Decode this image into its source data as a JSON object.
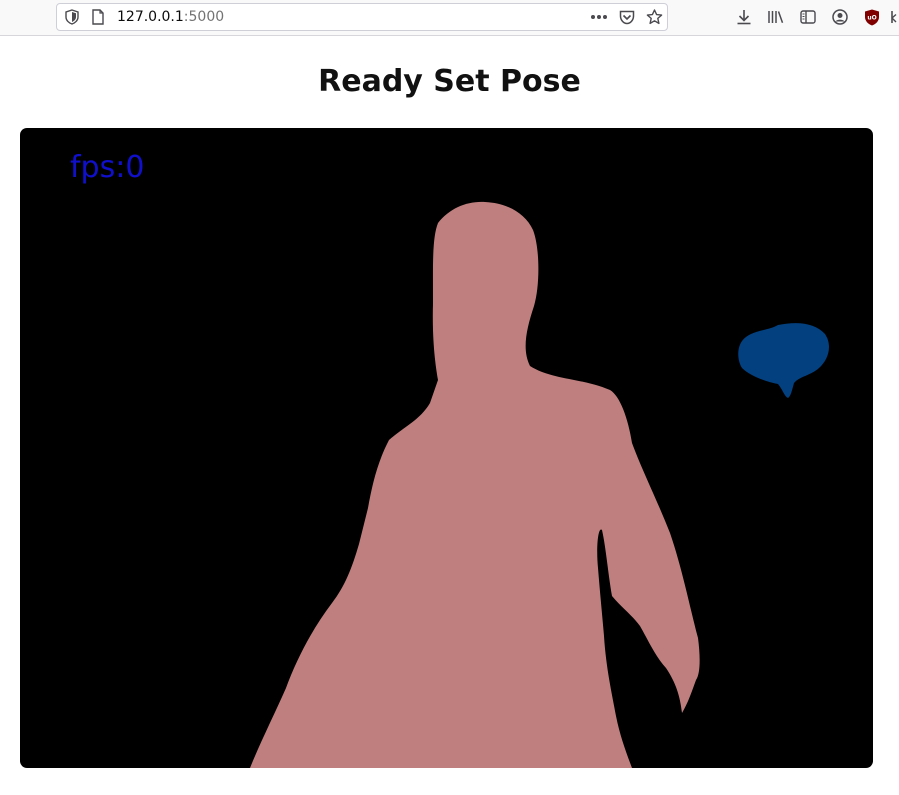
{
  "browser": {
    "url_host": "127.0.0.1",
    "url_port": ":5000",
    "icons": {
      "shield": "tracking-protection-shield-icon",
      "page": "page-info-icon",
      "more": "page-actions-more-icon",
      "pocket": "pocket-icon",
      "bookmark": "bookmark-star-icon",
      "download": "downloads-icon",
      "library": "library-icon",
      "sidebar": "sidebar-icon",
      "account": "account-icon",
      "ublock": "ublock-origin-icon"
    },
    "ublock_color": "#800000"
  },
  "page": {
    "title": "Ready Set Pose"
  },
  "canvas": {
    "fps_label": "fps:0",
    "fps_color": "#1010cc",
    "background_color": "#000000",
    "person_mask_color": "#c07f7f",
    "object_mask_color": "#03407f"
  }
}
